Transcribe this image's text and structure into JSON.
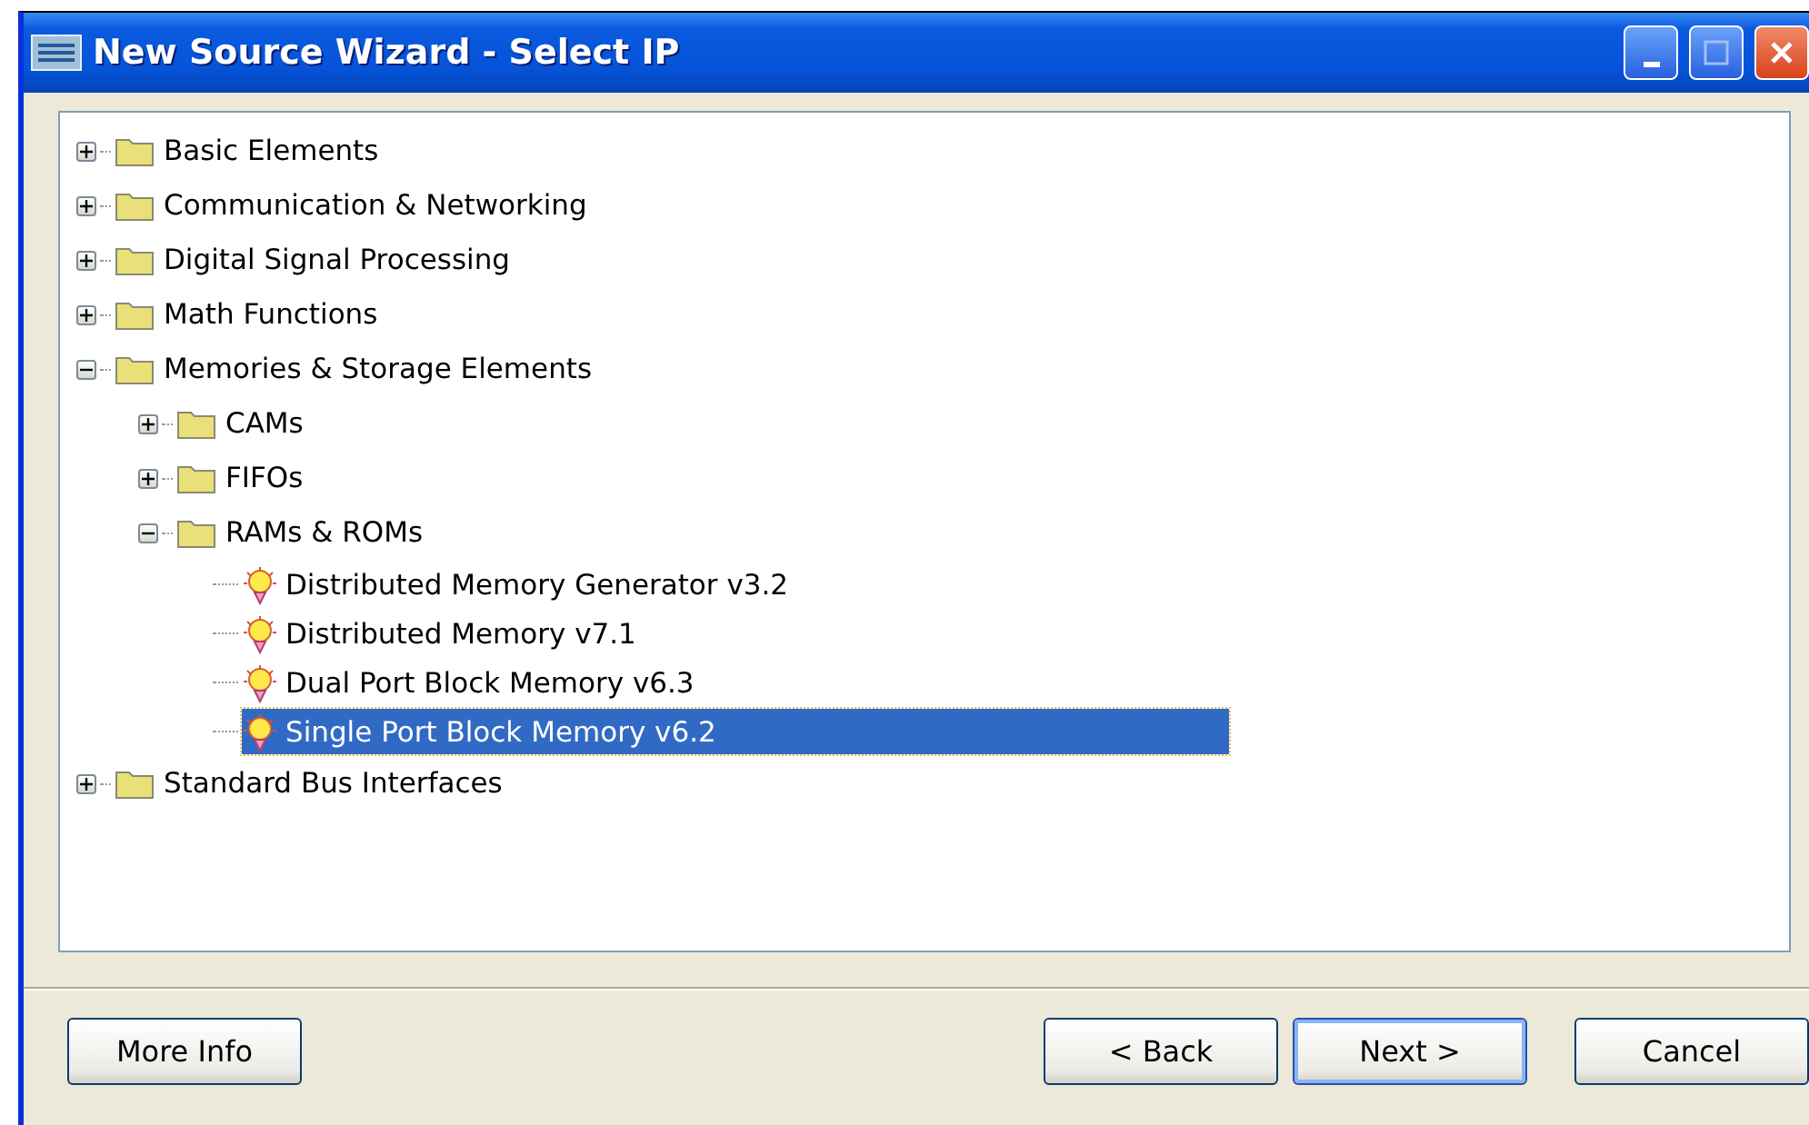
{
  "window": {
    "title": "New Source Wizard - Select IP"
  },
  "tree": [
    {
      "kind": "folder",
      "label": "Basic Elements",
      "expanded": false,
      "selected": false
    },
    {
      "kind": "folder",
      "label": "Communication & Networking",
      "expanded": false,
      "selected": false
    },
    {
      "kind": "folder",
      "label": "Digital Signal Processing",
      "expanded": false,
      "selected": false
    },
    {
      "kind": "folder",
      "label": "Math Functions",
      "expanded": false,
      "selected": false
    },
    {
      "kind": "folder",
      "label": "Memories & Storage Elements",
      "expanded": true,
      "selected": false,
      "children": [
        {
          "kind": "folder",
          "label": "CAMs",
          "expanded": false,
          "selected": false
        },
        {
          "kind": "folder",
          "label": "FIFOs",
          "expanded": false,
          "selected": false
        },
        {
          "kind": "folder",
          "label": "RAMs & ROMs",
          "expanded": true,
          "selected": false,
          "children": [
            {
              "kind": "core",
              "label": "Distributed Memory Generator v3.2",
              "selected": false
            },
            {
              "kind": "core",
              "label": "Distributed Memory v7.1",
              "selected": false
            },
            {
              "kind": "core",
              "label": "Dual Port Block Memory v6.3",
              "selected": false
            },
            {
              "kind": "core",
              "label": "Single Port Block Memory v6.2",
              "selected": true
            }
          ]
        }
      ]
    },
    {
      "kind": "folder",
      "label": "Standard Bus Interfaces",
      "expanded": false,
      "selected": false
    }
  ],
  "buttons": [
    {
      "label": "More Info",
      "default": false
    },
    {
      "label": "< Back",
      "default": false
    },
    {
      "label": "Next >",
      "default": true
    },
    {
      "label": "Cancel",
      "default": false
    }
  ]
}
